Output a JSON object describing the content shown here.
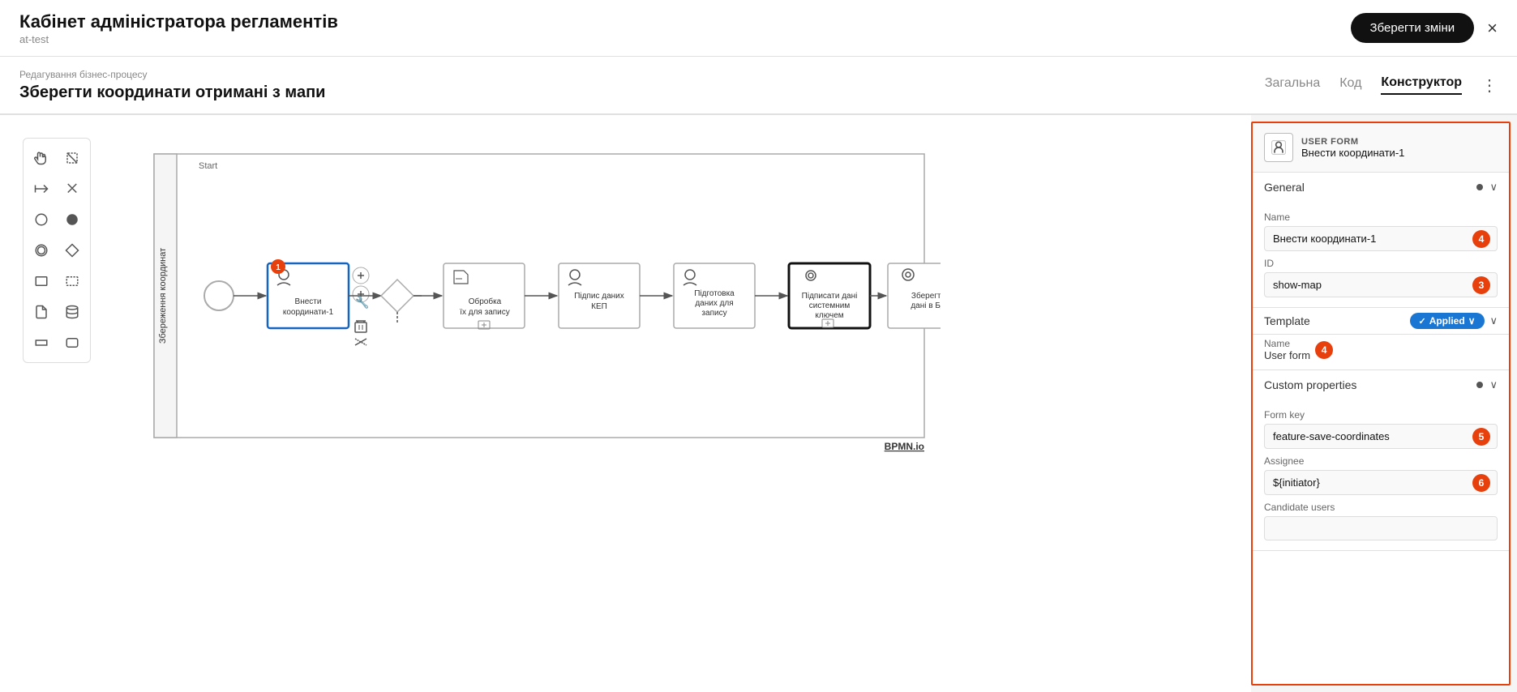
{
  "app": {
    "title": "Кабінет адміністратора регламентів",
    "subtitle": "at-test",
    "save_button": "Зберегти зміни",
    "close_icon": "×"
  },
  "sub_header": {
    "breadcrumb": "Редагування бізнес-процесу",
    "page_title": "Зберегти координати отримані з мапи",
    "tabs": [
      {
        "id": "general",
        "label": "Загальна",
        "active": false
      },
      {
        "id": "code",
        "label": "Код",
        "active": false
      },
      {
        "id": "constructor",
        "label": "Конструктор",
        "active": true
      }
    ],
    "more_icon": "⋮"
  },
  "panel": {
    "type": "USER FORM",
    "name": "Внести координати-1",
    "sections": {
      "general": {
        "title": "General",
        "name_label": "Name",
        "name_value": "Внести координати-1",
        "id_label": "ID",
        "id_value": "show-map"
      },
      "template": {
        "title": "Template",
        "applied_label": "Applied",
        "name_label": "Name",
        "name_value": "User form",
        "badge_number": "4"
      },
      "custom_properties": {
        "title": "Custom properties",
        "form_key_label": "Form key",
        "form_key_value": "feature-save-coordinates",
        "assignee_label": "Assignee",
        "assignee_value": "${initiator}",
        "candidate_users_label": "Candidate users",
        "badge_form_key": "5",
        "badge_assignee": "6"
      }
    }
  },
  "toolbar": {
    "tools": [
      {
        "id": "hand",
        "icon": "✋",
        "label": "hand-tool"
      },
      {
        "id": "cross",
        "icon": "✛",
        "label": "cross-tool"
      },
      {
        "id": "arrow-inout",
        "icon": "↔",
        "label": "arrow-inout-tool"
      },
      {
        "id": "diagonal",
        "icon": "↗",
        "label": "diagonal-tool"
      },
      {
        "id": "circle",
        "icon": "○",
        "label": "circle-tool"
      },
      {
        "id": "circle-thick",
        "icon": "●",
        "label": "circle-thick-tool"
      },
      {
        "id": "circle-outline",
        "icon": "◎",
        "label": "circle-outline-tool"
      },
      {
        "id": "diamond",
        "icon": "◇",
        "label": "diamond-tool"
      },
      {
        "id": "square",
        "icon": "□",
        "label": "square-tool"
      },
      {
        "id": "rect-dashed",
        "icon": "▭",
        "label": "rect-dashed-tool"
      },
      {
        "id": "page",
        "icon": "🗋",
        "label": "page-tool"
      },
      {
        "id": "cylinder",
        "icon": "⬤",
        "label": "cylinder-tool"
      },
      {
        "id": "rect-single",
        "icon": "▬",
        "label": "rect-single-tool"
      },
      {
        "id": "rect-corners",
        "icon": "⬜",
        "label": "rect-corners-tool"
      }
    ]
  },
  "bpmn": {
    "pool_label": "Збереження координат",
    "start_label": "Start",
    "watermark": "BPMN.io",
    "nodes": [
      {
        "id": "start",
        "type": "start-event",
        "label": ""
      },
      {
        "id": "user-task-1",
        "type": "user-task",
        "label": "Внести координати-1",
        "selected": true,
        "badge": "1"
      },
      {
        "id": "gateway-1",
        "type": "exclusive-gateway",
        "label": ""
      },
      {
        "id": "subprocess",
        "type": "subprocess",
        "label": "Обробка їх для запису"
      },
      {
        "id": "user-task-2",
        "type": "user-task",
        "label": "Підпис даних КЕП"
      },
      {
        "id": "user-task-3",
        "type": "user-task",
        "label": "Підготовка даних для запису"
      },
      {
        "id": "user-task-4",
        "type": "user-task",
        "label": "Підписати дані системним ключем",
        "bold_border": true
      },
      {
        "id": "user-task-5",
        "type": "user-task",
        "label": "Зберегти дані в БД"
      },
      {
        "id": "end",
        "type": "end-event",
        "label": ""
      }
    ]
  }
}
